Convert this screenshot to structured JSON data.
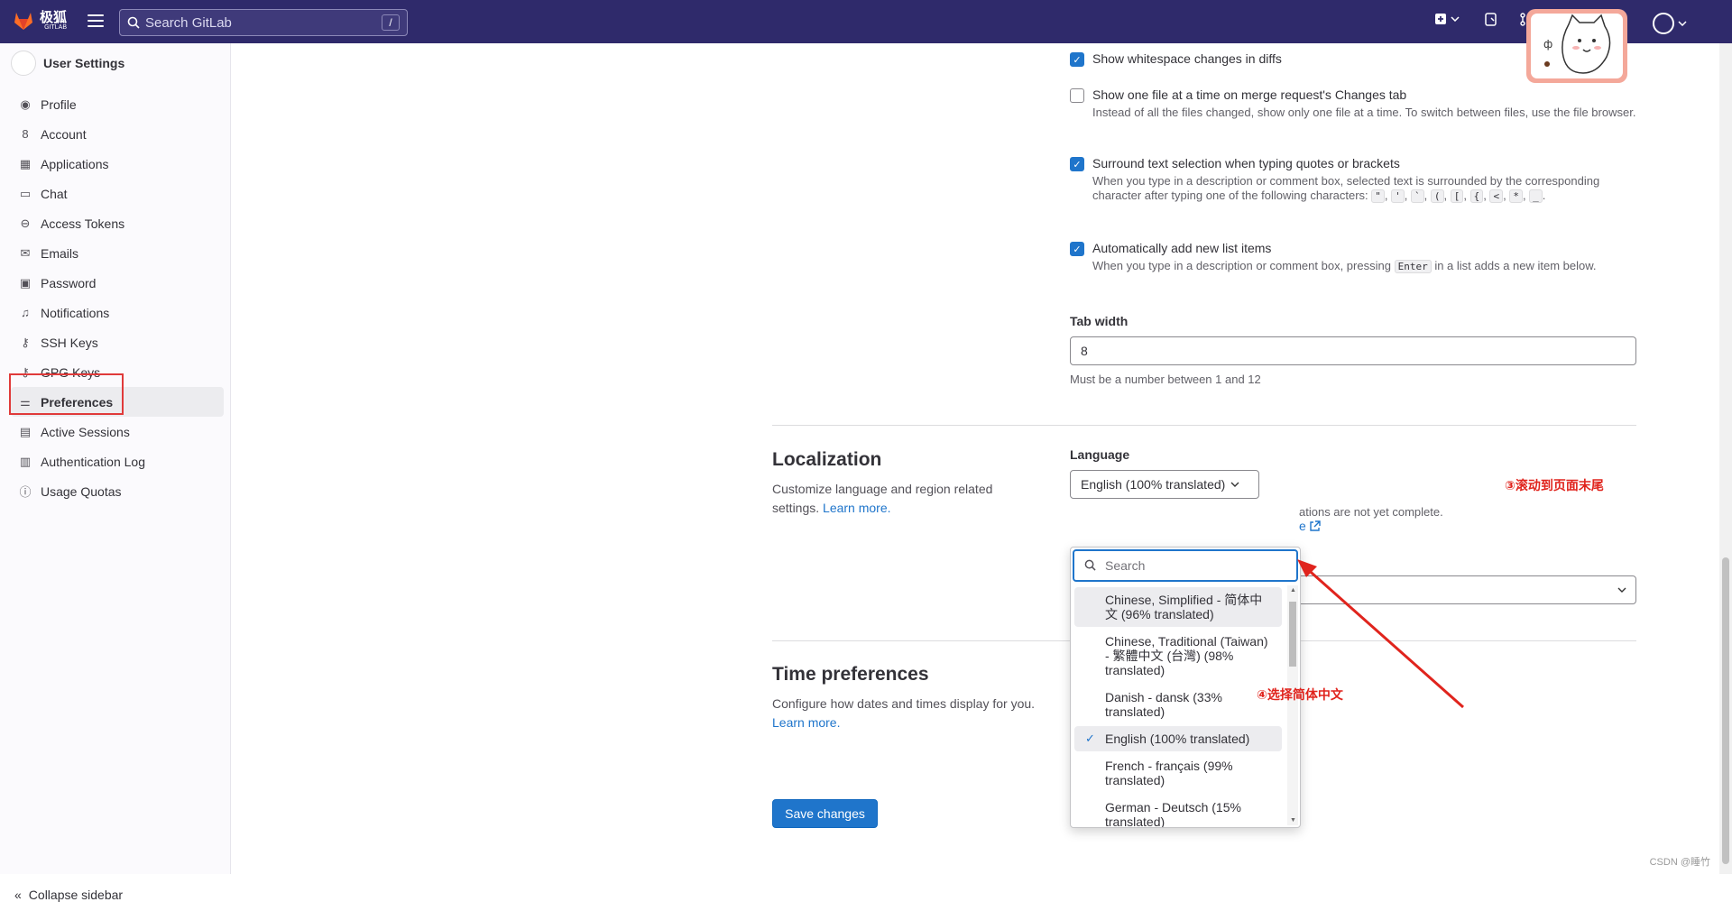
{
  "topbar": {
    "logo_text": "极狐",
    "logo_sub": "GITLAB",
    "search_placeholder": "Search GitLab",
    "search_shortcut": "/"
  },
  "sidebar": {
    "title": "User Settings",
    "items": [
      {
        "label": "Profile",
        "icon": "profile-icon"
      },
      {
        "label": "Account",
        "icon": "account-icon"
      },
      {
        "label": "Applications",
        "icon": "applications-icon"
      },
      {
        "label": "Chat",
        "icon": "chat-icon"
      },
      {
        "label": "Access Tokens",
        "icon": "token-icon"
      },
      {
        "label": "Emails",
        "icon": "mail-icon"
      },
      {
        "label": "Password",
        "icon": "lock-icon"
      },
      {
        "label": "Notifications",
        "icon": "bell-icon"
      },
      {
        "label": "SSH Keys",
        "icon": "key-icon"
      },
      {
        "label": "GPG Keys",
        "icon": "key-icon"
      },
      {
        "label": "Preferences",
        "icon": "preferences-icon"
      },
      {
        "label": "Active Sessions",
        "icon": "monitor-icon"
      },
      {
        "label": "Authentication Log",
        "icon": "log-icon"
      },
      {
        "label": "Usage Quotas",
        "icon": "quota-icon"
      }
    ],
    "collapse_label": "Collapse sidebar"
  },
  "behavior": {
    "whitespace_label": "Show whitespace changes in diffs",
    "one_file_label": "Show one file at a time on merge request's Changes tab",
    "one_file_help": "Instead of all the files changed, show only one file at a time. To switch between files, use the file browser.",
    "surround_label": "Surround text selection when typing quotes or brackets",
    "surround_help": "When you type in a description or comment box, selected text is surrounded by the corresponding character after typing one of the following characters:",
    "surround_chars": [
      "\"",
      "'",
      "`",
      "(",
      "[",
      "{",
      "<",
      "*",
      "_"
    ],
    "list_items_label": "Automatically add new list items",
    "list_items_help_pre": "When you type in a description or comment box, pressing",
    "list_items_key": "Enter",
    "list_items_help_post": "in a list adds a new item below.",
    "tab_width_label": "Tab width",
    "tab_width_value": "8",
    "tab_width_help": "Must be a number between 1 and 12"
  },
  "localization": {
    "title": "Localization",
    "desc": "Customize language and region related settings.",
    "learn_more": "Learn more.",
    "language_label": "Language",
    "language_value": "English (100% translated)",
    "partial_note": "ations are not yet complete.",
    "partial_link": "e"
  },
  "time_prefs": {
    "title": "Time preferences",
    "desc": "Configure how dates and times display for you.",
    "learn_more": "Learn more."
  },
  "save_label": "Save changes",
  "dropdown": {
    "search_placeholder": "Search",
    "items": [
      {
        "label": "Chinese, Simplified - 简体中文 (96% translated)",
        "state": "hover"
      },
      {
        "label": "Chinese, Traditional (Taiwan) - 繁體中文 (台灣) (98% translated)",
        "state": ""
      },
      {
        "label": "Danish - dansk (33% translated)",
        "state": ""
      },
      {
        "label": "English (100% translated)",
        "state": "selected"
      },
      {
        "label": "French - français (99% translated)",
        "state": ""
      },
      {
        "label": "German - Deutsch (15% translated)",
        "state": ""
      }
    ]
  },
  "annotations": {
    "scroll_note": "③滚动到页面末尾",
    "select_note": "④选择简体中文",
    "color": "#e0241d"
  },
  "watermark": "CSDN @睡竹"
}
